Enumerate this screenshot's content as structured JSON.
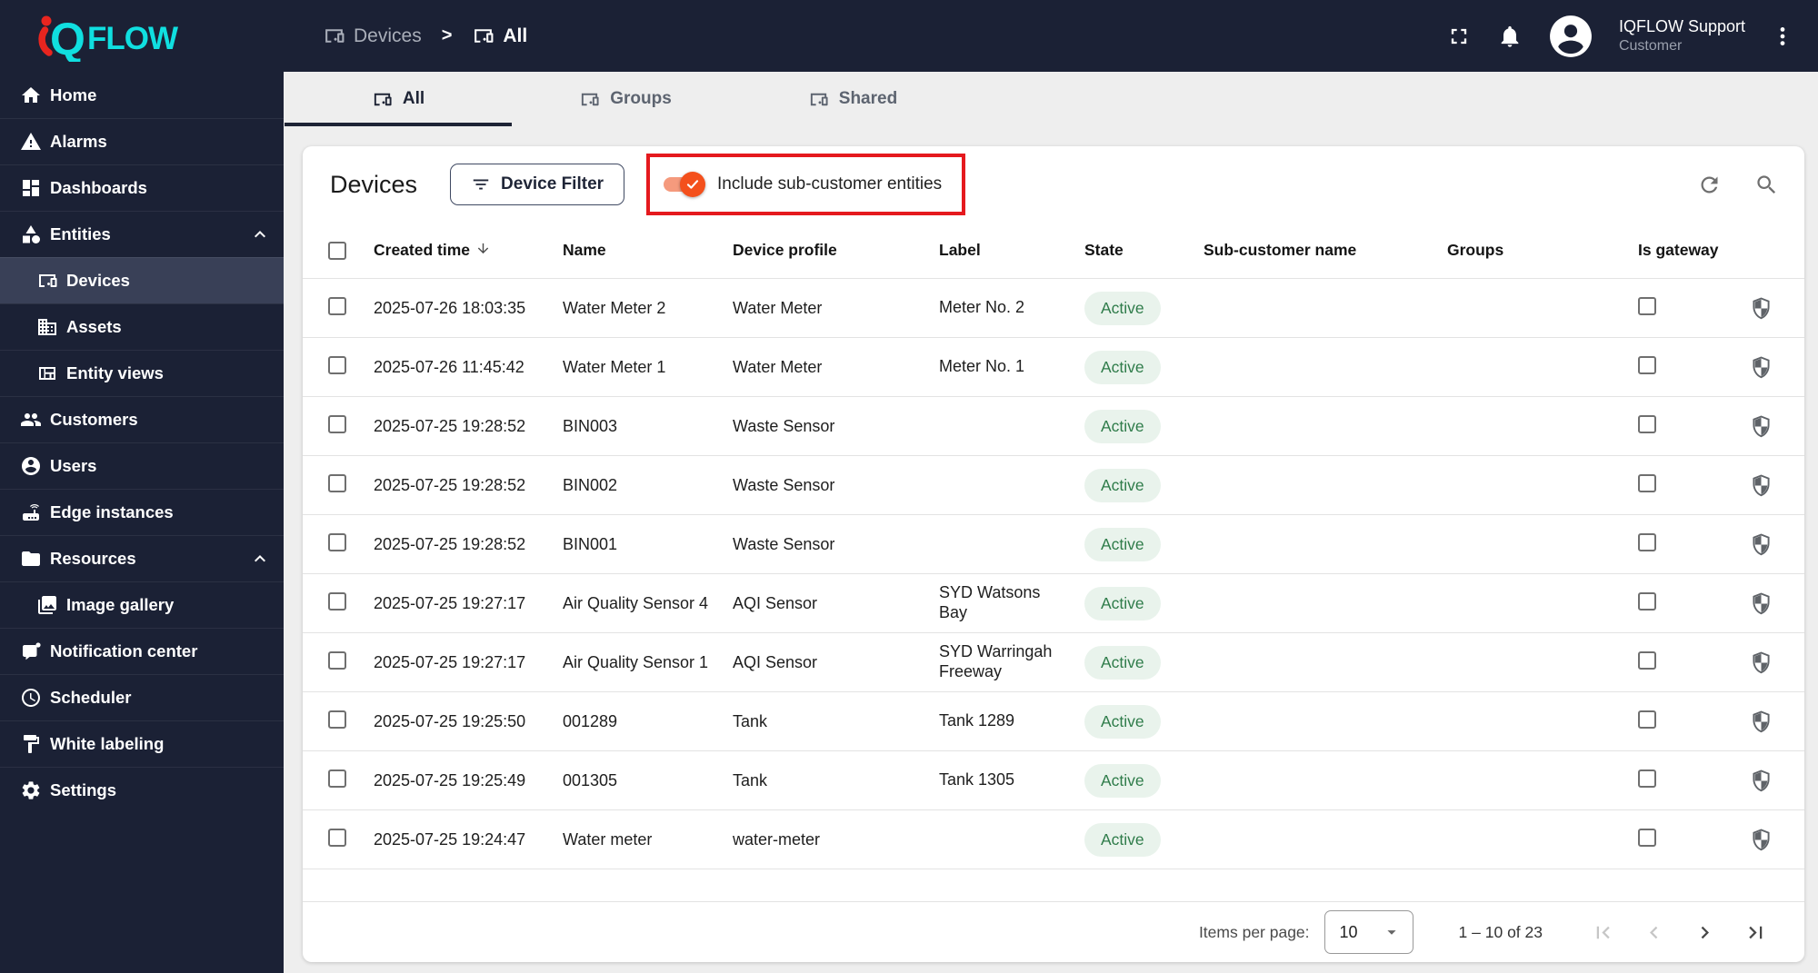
{
  "header": {
    "logo_q": "Q",
    "logo_rest": "FLOW",
    "breadcrumb": [
      {
        "label": "Devices"
      },
      {
        "label": "All"
      }
    ],
    "breadcrumb_separator": ">",
    "user": {
      "name": "IQFLOW Support",
      "role": "Customer"
    }
  },
  "sidebar": {
    "items": [
      {
        "label": "Home"
      },
      {
        "label": "Alarms"
      },
      {
        "label": "Dashboards"
      },
      {
        "label": "Entities",
        "expanded": true
      },
      {
        "label": "Devices",
        "sub": true,
        "selected": true
      },
      {
        "label": "Assets",
        "sub": true
      },
      {
        "label": "Entity views",
        "sub": true
      },
      {
        "label": "Customers"
      },
      {
        "label": "Users"
      },
      {
        "label": "Edge instances"
      },
      {
        "label": "Resources",
        "expanded": true
      },
      {
        "label": "Image gallery",
        "sub": true
      },
      {
        "label": "Notification center"
      },
      {
        "label": "Scheduler"
      },
      {
        "label": "White labeling"
      },
      {
        "label": "Settings"
      }
    ]
  },
  "tabs": {
    "items": [
      {
        "label": "All"
      },
      {
        "label": "Groups"
      },
      {
        "label": "Shared"
      }
    ],
    "active_index": 0
  },
  "toolbar": {
    "title": "Devices",
    "filter_button_label": "Device Filter",
    "toggle_label": "Include sub-customer entities",
    "toggle_on": true
  },
  "table": {
    "columns": [
      "Created time",
      "Name",
      "Device profile",
      "Label",
      "State",
      "Sub-customer name",
      "Groups",
      "Is gateway"
    ],
    "sort_column": "Created time",
    "sort_direction": "desc",
    "rows": [
      {
        "created": "2025-07-26 18:03:35",
        "name": "Water Meter 2",
        "profile": "Water Meter",
        "label": "Meter No. 2",
        "state": "Active",
        "subcustomer": "",
        "groups": "",
        "gateway": false
      },
      {
        "created": "2025-07-26 11:45:42",
        "name": "Water Meter 1",
        "profile": "Water Meter",
        "label": "Meter No. 1",
        "state": "Active",
        "subcustomer": "",
        "groups": "",
        "gateway": false
      },
      {
        "created": "2025-07-25 19:28:52",
        "name": "BIN003",
        "profile": "Waste Sensor",
        "label": "",
        "state": "Active",
        "subcustomer": "",
        "groups": "",
        "gateway": false
      },
      {
        "created": "2025-07-25 19:28:52",
        "name": "BIN002",
        "profile": "Waste Sensor",
        "label": "",
        "state": "Active",
        "subcustomer": "",
        "groups": "",
        "gateway": false
      },
      {
        "created": "2025-07-25 19:28:52",
        "name": "BIN001",
        "profile": "Waste Sensor",
        "label": "",
        "state": "Active",
        "subcustomer": "",
        "groups": "",
        "gateway": false
      },
      {
        "created": "2025-07-25 19:27:17",
        "name": "Air Quality Sensor 4",
        "profile": "AQI Sensor",
        "label": "SYD Watsons Bay",
        "state": "Active",
        "subcustomer": "",
        "groups": "",
        "gateway": false
      },
      {
        "created": "2025-07-25 19:27:17",
        "name": "Air Quality Sensor 1",
        "profile": "AQI Sensor",
        "label": "SYD Warringah Freeway",
        "state": "Active",
        "subcustomer": "",
        "groups": "",
        "gateway": false
      },
      {
        "created": "2025-07-25 19:25:50",
        "name": "001289",
        "profile": "Tank",
        "label": "Tank 1289",
        "state": "Active",
        "subcustomer": "",
        "groups": "",
        "gateway": false
      },
      {
        "created": "2025-07-25 19:25:49",
        "name": "001305",
        "profile": "Tank",
        "label": "Tank 1305",
        "state": "Active",
        "subcustomer": "",
        "groups": "",
        "gateway": false
      },
      {
        "created": "2025-07-25 19:24:47",
        "name": "Water meter",
        "profile": "water-meter",
        "label": "",
        "state": "Active",
        "subcustomer": "",
        "groups": "",
        "gateway": false
      }
    ]
  },
  "pagination": {
    "items_per_page_label": "Items per page:",
    "page_size": "10",
    "range_label": "1 – 10 of 23"
  },
  "icons": {
    "breadcrumb_entity": "devices-icon",
    "header_right": [
      "fullscreen-icon",
      "bell-icon",
      "avatar-icon",
      "kebab-menu-icon"
    ],
    "toolbar": [
      "filter-list-icon",
      "refresh-icon",
      "search-icon"
    ],
    "sort": "arrow-down-icon",
    "row_action": "shield-icon"
  },
  "colors": {
    "header_bg": "#1b2135",
    "selected_nav_bg": "#394057",
    "brand_cyan": "#10dfe0",
    "brand_red": "#e8251f",
    "annotation_red": "#e5191e",
    "toggle_thumb_orange": "#f4501c",
    "toggle_track_orange": "#f59a7d",
    "active_badge_bg": "#e9f3ec",
    "active_badge_text": "#2f7c4a",
    "page_bg": "#eeeeee"
  }
}
